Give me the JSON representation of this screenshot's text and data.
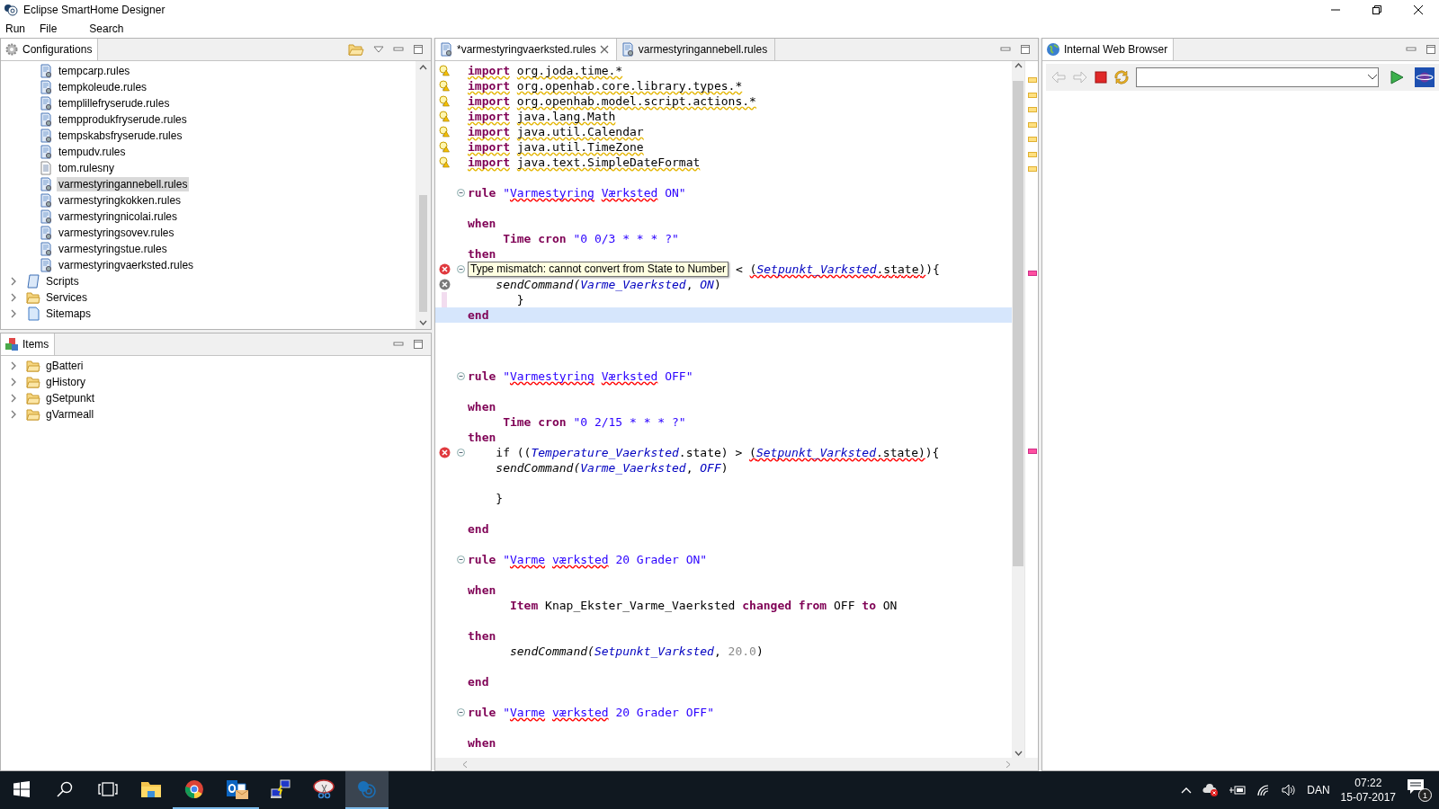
{
  "window": {
    "title": "Eclipse SmartHome Designer"
  },
  "menu": [
    "Run",
    "File",
    "Search"
  ],
  "configurations": {
    "title": "Configurations",
    "files": [
      {
        "label": "tempcarp.rules",
        "kind": "rules",
        "selected": false
      },
      {
        "label": "tempkoleude.rules",
        "kind": "rules",
        "selected": false
      },
      {
        "label": "templillefryserude.rules",
        "kind": "rules",
        "selected": false
      },
      {
        "label": "tempprodukfryserude.rules",
        "kind": "rules",
        "selected": false
      },
      {
        "label": "tempskabsfryserude.rules",
        "kind": "rules",
        "selected": false
      },
      {
        "label": "tempudv.rules",
        "kind": "rules",
        "selected": false
      },
      {
        "label": "tom.rulesny",
        "kind": "text",
        "selected": false
      },
      {
        "label": "varmestyringannebell.rules",
        "kind": "rules",
        "selected": true
      },
      {
        "label": "varmestyringkokken.rules",
        "kind": "rules",
        "selected": false
      },
      {
        "label": "varmestyringnicolai.rules",
        "kind": "rules",
        "selected": false
      },
      {
        "label": "varmestyringsovev.rules",
        "kind": "rules",
        "selected": false
      },
      {
        "label": "varmestyringstue.rules",
        "kind": "rules",
        "selected": false
      },
      {
        "label": "varmestyringvaerksted.rules",
        "kind": "rules",
        "selected": false
      }
    ],
    "folders": [
      {
        "label": "Scripts",
        "kind": "script",
        "expanded": false
      },
      {
        "label": "Services",
        "kind": "folder",
        "expanded": false
      },
      {
        "label": "Sitemaps",
        "kind": "sitemap",
        "expanded": false
      }
    ]
  },
  "items": {
    "title": "Items",
    "folders": [
      {
        "label": "gBatteri",
        "expanded": false
      },
      {
        "label": "gHistory",
        "expanded": false
      },
      {
        "label": "gSetpunkt",
        "expanded": false
      },
      {
        "label": "gVarmeall",
        "expanded": false
      }
    ]
  },
  "editor": {
    "tabs": [
      {
        "label": "*varmestyringvaerksted.rules",
        "selected": true
      },
      {
        "label": "varmestyringannebell.rules",
        "selected": false
      }
    ],
    "lines": [
      {
        "kind": "warning",
        "current": false,
        "segs": [
          {
            "t": "import",
            "kind": "keyword",
            "warn": true
          },
          {
            "t": " org.joda.time.*",
            "kind": "plain",
            "warn": true
          }
        ]
      },
      {
        "kind": "warning",
        "current": false,
        "segs": [
          {
            "t": "import",
            "kind": "keyword",
            "warn": true
          },
          {
            "t": " org.openhab.core.library.types.*",
            "kind": "plain",
            "warn": true
          }
        ]
      },
      {
        "kind": "warning",
        "current": false,
        "segs": [
          {
            "t": "import",
            "kind": "keyword",
            "warn": true
          },
          {
            "t": " org.openhab.model.script.actions.*",
            "kind": "plain",
            "warn": true
          }
        ]
      },
      {
        "kind": "warning",
        "current": false,
        "segs": [
          {
            "t": "import",
            "kind": "keyword",
            "warn": true
          },
          {
            "t": " java.lang.Math",
            "kind": "plain",
            "warn": true
          }
        ]
      },
      {
        "kind": "warning",
        "current": false,
        "segs": [
          {
            "t": "import",
            "kind": "keyword",
            "warn": true
          },
          {
            "t": " java.util.Calendar",
            "kind": "plain",
            "warn": true
          }
        ]
      },
      {
        "kind": "warning",
        "current": false,
        "segs": [
          {
            "t": "import",
            "kind": "keyword",
            "warn": true
          },
          {
            "t": " java.util.TimeZone",
            "kind": "plain",
            "warn": true
          }
        ]
      },
      {
        "kind": "warning",
        "current": false,
        "segs": [
          {
            "t": "import",
            "kind": "keyword",
            "warn": true
          },
          {
            "t": " java.text.SimpleDateFormat",
            "kind": "plain",
            "warn": true
          }
        ]
      },
      {
        "kind": "plain",
        "current": false
      },
      {
        "kind": "plain",
        "fold": {
          "expanded": true
        },
        "current": false,
        "segs": [
          {
            "t": "rule ",
            "kind": "keyword"
          },
          {
            "t": "\"",
            "kind": "string"
          },
          {
            "t": "Varmestyring",
            "kind": "string",
            "spell": true
          },
          {
            "t": " Værksted",
            "kind": "string",
            "spell": true
          },
          {
            "t": " ON\"",
            "kind": "string"
          }
        ]
      },
      {
        "kind": "plain",
        "current": false
      },
      {
        "kind": "plain",
        "current": false,
        "segs": [
          {
            "t": "when",
            "kind": "keyword"
          }
        ]
      },
      {
        "kind": "plain",
        "current": false,
        "segs": [
          {
            "t": "     Time cron ",
            "kind": "keyword"
          },
          {
            "t": "\"0 0/3 * * * ?\"",
            "kind": "string"
          }
        ]
      },
      {
        "kind": "plain",
        "current": false,
        "segs": [
          {
            "t": "then",
            "kind": "keyword"
          }
        ]
      },
      {
        "kind": "error",
        "fold": {
          "expanded": true
        },
        "current": false,
        "tooltip": "Type mismatch: cannot convert from State to Number",
        "segs": [
          {
            "t": " < ",
            "kind": "plain"
          },
          {
            "t": "(",
            "kind": "plain",
            "spell": true
          },
          {
            "t": "Setpunkt_Varksted",
            "kind": "field",
            "spell": true
          },
          {
            "t": ".state)",
            "kind": "plain",
            "spell": true
          },
          {
            "t": "){",
            "kind": "plain"
          }
        ]
      },
      {
        "kind": "error-dim",
        "current": false,
        "segs": [
          {
            "t": "    sendCommand(",
            "kind": "call"
          },
          {
            "t": "Varme_Vaerksted",
            "kind": "field"
          },
          {
            "t": ", ",
            "kind": "plain"
          },
          {
            "t": "ON",
            "kind": "field"
          },
          {
            "t": ")",
            "kind": "plain"
          }
        ]
      },
      {
        "kind": "changed",
        "current": false,
        "segs": [
          {
            "t": "       }",
            "kind": "plain"
          }
        ]
      },
      {
        "kind": "plain",
        "current": true,
        "segs": [
          {
            "t": "end",
            "kind": "keyword"
          }
        ]
      },
      {
        "kind": "plain",
        "current": false
      },
      {
        "kind": "plain",
        "current": false
      },
      {
        "kind": "plain",
        "current": false
      },
      {
        "kind": "plain",
        "fold": {
          "expanded": true
        },
        "current": false,
        "segs": [
          {
            "t": "rule ",
            "kind": "keyword"
          },
          {
            "t": "\"",
            "kind": "string"
          },
          {
            "t": "Varmestyring",
            "kind": "string",
            "spell": true
          },
          {
            "t": " Værksted",
            "kind": "string",
            "spell": true
          },
          {
            "t": " OFF\"",
            "kind": "string"
          }
        ]
      },
      {
        "kind": "plain",
        "current": false
      },
      {
        "kind": "plain",
        "current": false,
        "segs": [
          {
            "t": "when",
            "kind": "keyword"
          }
        ]
      },
      {
        "kind": "plain",
        "current": false,
        "segs": [
          {
            "t": "     Time cron ",
            "kind": "keyword"
          },
          {
            "t": "\"0 2/15 * * * ?\"",
            "kind": "string"
          }
        ]
      },
      {
        "kind": "plain",
        "current": false,
        "segs": [
          {
            "t": "then",
            "kind": "keyword"
          }
        ]
      },
      {
        "kind": "error",
        "fold": {
          "expanded": true
        },
        "current": false,
        "segs": [
          {
            "t": "    if ((",
            "kind": "plain"
          },
          {
            "t": "Temperature_Vaerksted",
            "kind": "field"
          },
          {
            "t": ".state) > ",
            "kind": "plain"
          },
          {
            "t": "(",
            "kind": "plain",
            "spell": true
          },
          {
            "t": "Setpunkt_Varksted",
            "kind": "field",
            "spell": true
          },
          {
            "t": ".state)",
            "kind": "plain",
            "spell": true
          },
          {
            "t": "){",
            "kind": "plain"
          }
        ]
      },
      {
        "kind": "plain",
        "current": false,
        "segs": [
          {
            "t": "    sendCommand(",
            "kind": "call"
          },
          {
            "t": "Varme_Vaerksted",
            "kind": "field"
          },
          {
            "t": ", ",
            "kind": "plain"
          },
          {
            "t": "OFF",
            "kind": "field"
          },
          {
            "t": ")",
            "kind": "plain"
          }
        ]
      },
      {
        "kind": "plain",
        "current": false
      },
      {
        "kind": "plain",
        "current": false,
        "segs": [
          {
            "t": "    }",
            "kind": "plain"
          }
        ]
      },
      {
        "kind": "plain",
        "current": false
      },
      {
        "kind": "plain",
        "current": false,
        "segs": [
          {
            "t": "end",
            "kind": "keyword"
          }
        ]
      },
      {
        "kind": "plain",
        "current": false
      },
      {
        "kind": "plain",
        "fold": {
          "expanded": true
        },
        "current": false,
        "segs": [
          {
            "t": "rule ",
            "kind": "keyword"
          },
          {
            "t": "\"",
            "kind": "string"
          },
          {
            "t": "Varme",
            "kind": "string",
            "spell": true
          },
          {
            "t": " værksted",
            "kind": "string",
            "spell": true
          },
          {
            "t": " 20 Grader ON\"",
            "kind": "string"
          }
        ]
      },
      {
        "kind": "plain",
        "current": false
      },
      {
        "kind": "plain",
        "current": false,
        "segs": [
          {
            "t": "when",
            "kind": "keyword"
          }
        ]
      },
      {
        "kind": "plain",
        "current": false,
        "segs": [
          {
            "t": "      Item ",
            "kind": "keyword"
          },
          {
            "t": "Knap_Ekster_Varme_Vaerksted ",
            "kind": "plain"
          },
          {
            "t": "changed from ",
            "kind": "keyword"
          },
          {
            "t": "OFF ",
            "kind": "plain"
          },
          {
            "t": "to ",
            "kind": "keyword"
          },
          {
            "t": "ON",
            "kind": "plain"
          }
        ]
      },
      {
        "kind": "plain",
        "current": false
      },
      {
        "kind": "plain",
        "current": false,
        "segs": [
          {
            "t": "then",
            "kind": "keyword"
          }
        ]
      },
      {
        "kind": "plain",
        "current": false,
        "segs": [
          {
            "t": "      sendCommand(",
            "kind": "call"
          },
          {
            "t": "Setpunkt_Varksted",
            "kind": "field"
          },
          {
            "t": ", ",
            "kind": "plain"
          },
          {
            "t": "20.0",
            "kind": "number"
          },
          {
            "t": ")",
            "kind": "plain"
          }
        ]
      },
      {
        "kind": "plain",
        "current": false
      },
      {
        "kind": "plain",
        "current": false,
        "segs": [
          {
            "t": "end",
            "kind": "keyword"
          }
        ]
      },
      {
        "kind": "plain",
        "current": false
      },
      {
        "kind": "plain",
        "fold": {
          "expanded": true
        },
        "current": false,
        "segs": [
          {
            "t": "rule ",
            "kind": "keyword"
          },
          {
            "t": "\"",
            "kind": "string"
          },
          {
            "t": "Varme",
            "kind": "string",
            "spell": true
          },
          {
            "t": " værksted",
            "kind": "string",
            "spell": true
          },
          {
            "t": " 20 Grader OFF\"",
            "kind": "string"
          }
        ]
      },
      {
        "kind": "plain",
        "current": false
      },
      {
        "kind": "plain",
        "current": false,
        "segs": [
          {
            "t": "when",
            "kind": "keyword"
          }
        ]
      }
    ]
  },
  "browser": {
    "title": "Internal Web Browser"
  },
  "taskbar": {
    "apps": [
      {
        "kind": "explorer",
        "running": false,
        "selected": false
      },
      {
        "kind": "chrome",
        "running": true,
        "selected": false
      },
      {
        "kind": "outlook",
        "running": true,
        "selected": false
      },
      {
        "kind": "network",
        "running": false,
        "selected": false
      },
      {
        "kind": "snipping",
        "running": false,
        "selected": false
      },
      {
        "kind": "eclipse",
        "running": true,
        "selected": true
      }
    ],
    "language": "DAN",
    "time": "07:22",
    "date": "15-07-2017",
    "notifications": "1"
  }
}
